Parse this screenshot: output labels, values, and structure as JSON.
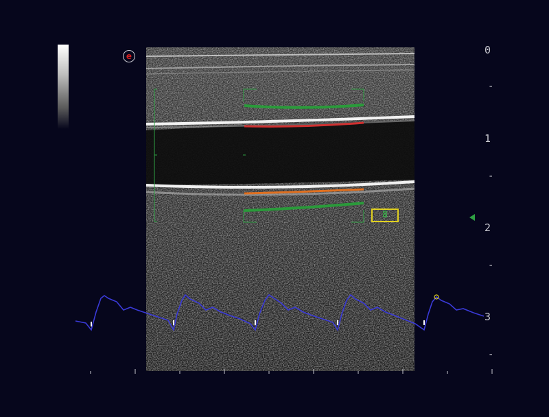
{
  "depth_scale": {
    "labels": [
      "0",
      "1",
      "2",
      "3"
    ]
  },
  "measurement_box": {
    "value": "8"
  },
  "logo": {
    "glyph": "e"
  },
  "colors": {
    "background": "#06061c",
    "ecg_trace": "#3a3ad8",
    "roi_bracket": "#2ea043",
    "intima_upper": "#d03030",
    "intima_lower": "#e07020",
    "adventitia": "#2a9a3a",
    "box_border": "#e0d020"
  },
  "icons": {
    "logo": "logo-badge-icon",
    "focus": "focus-marker-icon"
  }
}
